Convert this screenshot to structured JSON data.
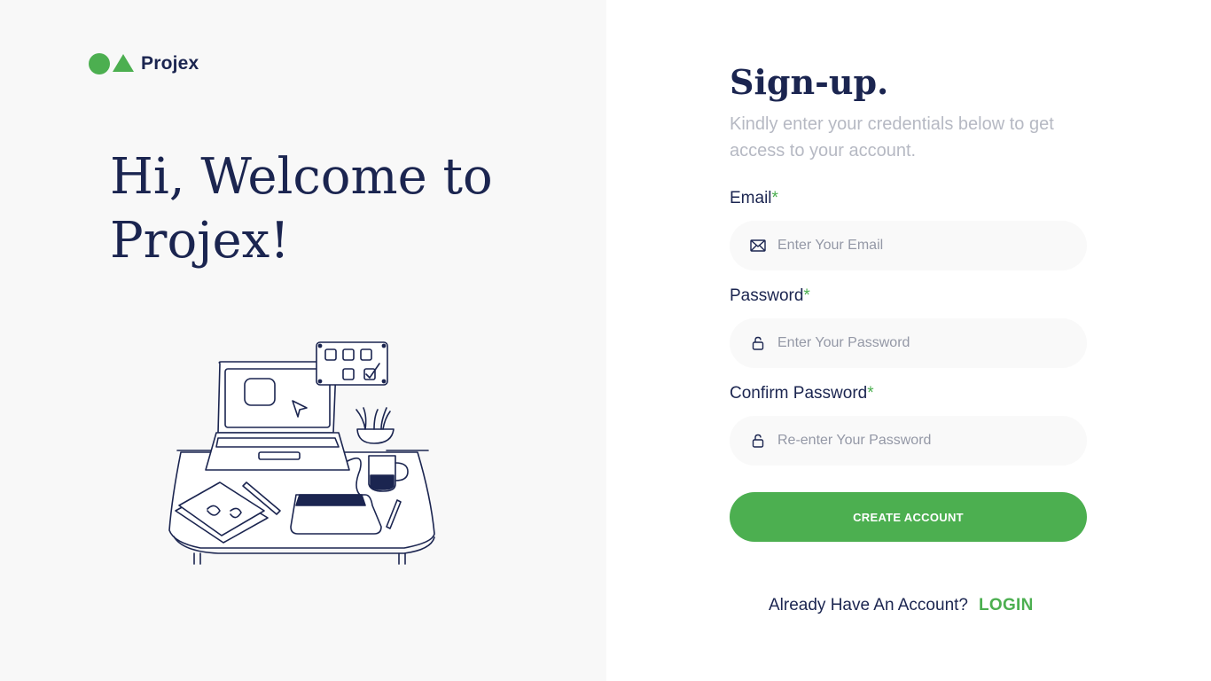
{
  "brand": {
    "name": "Projex",
    "accent_color": "#4caf50",
    "text_color": "#1b2550"
  },
  "hero": {
    "line1": "Hi, Welcome to",
    "line2": "Projex!",
    "illustration_icon": "desk-workspace-illustration"
  },
  "form": {
    "title": "Sign-up.",
    "subtitle": "Kindly enter your credentials below to get access to your account.",
    "required_mark": "*",
    "fields": [
      {
        "label": "Email",
        "placeholder": "Enter Your Email",
        "value": "",
        "icon": "envelope-icon"
      },
      {
        "label": "Password",
        "placeholder": "Enter Your Password",
        "value": "",
        "icon": "lock-icon"
      },
      {
        "label": "Confirm Password",
        "placeholder": "Re-enter Your Password",
        "value": "",
        "icon": "lock-icon"
      }
    ],
    "submit_label": "CREATE ACCOUNT",
    "login_prompt": "Already Have An Account?",
    "login_link": "LOGIN"
  }
}
